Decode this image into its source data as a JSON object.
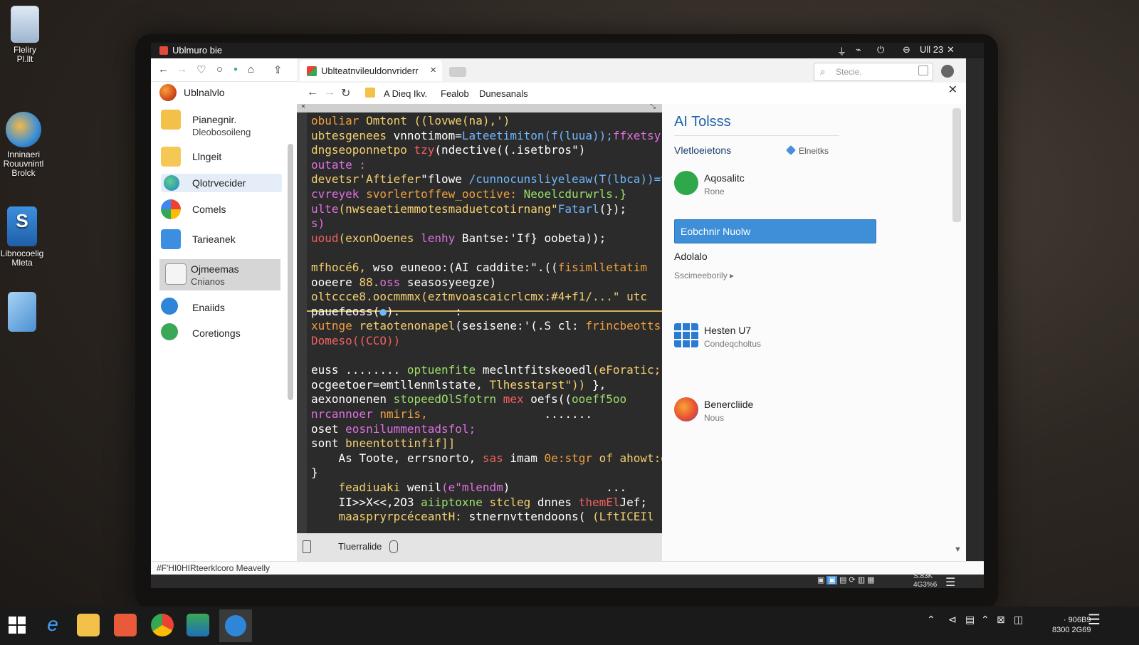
{
  "desktop_icons": [
    {
      "label_l1": "Fleliry",
      "label_l2": "Pl.llt"
    },
    {
      "label_l1": "Inninaeri",
      "label_l2": "Rouuvnintl",
      "label_l3": "Brolck"
    },
    {
      "label_l1": "Libnocoelig",
      "label_l2": "Mleta"
    },
    {
      "label_l1": ""
    }
  ],
  "window": {
    "title": "Ublmuro bie",
    "controls": [
      "⏚",
      "⌁",
      "⏻",
      "⊖",
      "Ull 23",
      "✕"
    ]
  },
  "file_manager": {
    "user": "Ublnalvlo",
    "items": [
      {
        "label": "Pianegnir.",
        "sub": "Dleobosoileng",
        "icon": "folder-doc-icon"
      },
      {
        "label": "Llngeit",
        "icon": "folder-icon"
      },
      {
        "label": "Qlotrvecider",
        "icon": "edge-icon"
      },
      {
        "label": "Comels",
        "icon": "cloud-icon"
      },
      {
        "label": "Tarieanek",
        "icon": "folder-blue-icon"
      },
      {
        "label": "Ojmeemas",
        "sub": "Cnianos",
        "icon": "file-icon"
      },
      {
        "label": "Enaiids",
        "icon": "refresh-icon"
      },
      {
        "label": "Coretiongs",
        "icon": "wrench-icon"
      }
    ],
    "status": "#F'HI0HIRteerklcoro Meavelly"
  },
  "browser": {
    "tab_title": "Ublteatnvileuldonvriderr",
    "search_placeholder": "Stecie.",
    "address_parts": [
      "A Dieq Ikv.",
      "Fealob",
      "Dunesanals"
    ]
  },
  "editor": {
    "footer_label": "Tluerralide",
    "lines": [
      {
        "segments": [
          {
            "t": "obuliar ",
            "c": "#f0a040"
          },
          {
            "t": "Omtont ((lovwe(na),')",
            "c": "#f4d06f"
          }
        ]
      },
      {
        "segments": [
          {
            "t": "ubtesgenees ",
            "c": "#f4d06f"
          },
          {
            "t": "vnnotimom=",
            "c": "#ffffff"
          },
          {
            "t": "Lateetimiton(f(luua));",
            "c": "#6fb8ff"
          },
          {
            "t": "ffxetsy",
            "c": "#e070e0"
          }
        ]
      },
      {
        "segments": [
          {
            "t": "dngseoponnetpo ",
            "c": "#f4d06f"
          },
          {
            "t": "tzy",
            "c": "#f06060"
          },
          {
            "t": "(ndective((.isetbros\")",
            "c": "#ffffff"
          }
        ]
      },
      {
        "segments": [
          {
            "t": "outate :",
            "c": "#e070e0"
          }
        ]
      },
      {
        "segments": [
          {
            "t": "devetsr'Aftiefer",
            "c": "#f4d06f"
          },
          {
            "t": "\"flowe ",
            "c": "#ffffff"
          },
          {
            "t": "/cunnocunsliyeleaw(T(lbca))=vsr",
            "c": "#6fb8ff"
          }
        ]
      },
      {
        "segments": [
          {
            "t": "cvreyek ",
            "c": "#e070e0"
          },
          {
            "t": "svorlertoffew_ooctive: ",
            "c": "#f0a040"
          },
          {
            "t": "Neoelcdurwrls.}",
            "c": "#9be06b"
          }
        ]
      },
      {
        "segments": [
          {
            "t": "ulte",
            "c": "#e070e0"
          },
          {
            "t": "(nwseaetiemmotesmaduetcotirnang\"",
            "c": "#f4d06f"
          },
          {
            "t": "Fatarl",
            "c": "#6fb8ff"
          },
          {
            "t": "(});",
            "c": "#ffffff"
          }
        ]
      },
      {
        "segments": [
          {
            "t": "s)",
            "c": "#e070e0"
          }
        ]
      },
      {
        "segments": [
          {
            "t": "uoud",
            "c": "#f06060"
          },
          {
            "t": "(exonOoenes ",
            "c": "#f4d06f"
          },
          {
            "t": "lenhy ",
            "c": "#e070e0"
          },
          {
            "t": "Bantse:'If} ",
            "c": "#ffffff"
          },
          {
            "t": "oobeta));",
            "c": "#ffffff"
          }
        ]
      },
      {
        "segments": [
          {
            "t": "",
            "c": "#ffffff"
          }
        ]
      },
      {
        "segments": [
          {
            "t": "mfhocé6, ",
            "c": "#f4d06f"
          },
          {
            "t": "wso euneoo:(AI caddite:\".((",
            "c": "#ffffff"
          },
          {
            "t": "fisimlletatim",
            "c": "#f0a040"
          }
        ]
      },
      {
        "segments": [
          {
            "t": "ooeere ",
            "c": "#ffffff"
          },
          {
            "t": "88.",
            "c": "#f4d06f"
          },
          {
            "t": "oss ",
            "c": "#e070e0"
          },
          {
            "t": "seasosyeegze)",
            "c": "#ffffff"
          }
        ]
      },
      {
        "segments": [
          {
            "t": "oltccce8.oocmmmx(eztmvoascaicrlcmx:#4+f1/...\" utc",
            "c": "#f4d06f"
          }
        ]
      },
      {
        "segments": [
          {
            "t": "pauefeoss(",
            "c": "#ffffff"
          },
          {
            "t": "●",
            "c": "#6fb8ff"
          },
          {
            "t": ").        :",
            "c": "#ffffff"
          }
        ]
      },
      {
        "segments": [
          {
            "t": "xutnge ",
            "c": "#f0a040"
          },
          {
            "t": "retaotenonapel",
            "c": "#f4d06f"
          },
          {
            "t": "(sesisene:'(.S cl: ",
            "c": "#ffffff"
          },
          {
            "t": "frincbeotts-%",
            "c": "#f0a040"
          }
        ]
      },
      {
        "segments": [
          {
            "t": "Domeso((CCO))",
            "c": "#f06060"
          }
        ]
      },
      {
        "segments": [
          {
            "t": "",
            "c": "#ffffff"
          }
        ]
      },
      {
        "segments": [
          {
            "t": "euss ........ ",
            "c": "#ffffff"
          },
          {
            "t": "optuenfite ",
            "c": "#9be06b"
          },
          {
            "t": "meclntfitskeoedl",
            "c": "#ffffff"
          },
          {
            "t": "(eForatic;('ofmm",
            "c": "#f4d06f"
          }
        ]
      },
      {
        "segments": [
          {
            "t": "ocgeetoer=emtllenmlstate, ",
            "c": "#ffffff"
          },
          {
            "t": "Tlhesstarst\")) ",
            "c": "#f4d06f"
          },
          {
            "t": "},",
            "c": "#ffffff"
          }
        ]
      },
      {
        "segments": [
          {
            "t": "aexononenen ",
            "c": "#ffffff"
          },
          {
            "t": "stopeedOlSfotrn ",
            "c": "#9be06b"
          },
          {
            "t": "mex ",
            "c": "#f06060"
          },
          {
            "t": "oefs((",
            "c": "#ffffff"
          },
          {
            "t": "ooeff5oo",
            "c": "#9be06b"
          }
        ]
      },
      {
        "segments": [
          {
            "t": "nrcannoer ",
            "c": "#e070e0"
          },
          {
            "t": "nmiris,",
            "c": "#f0a040"
          },
          {
            "t": "                 .......",
            "c": "#ffffff"
          }
        ]
      },
      {
        "segments": [
          {
            "t": "oset ",
            "c": "#ffffff"
          },
          {
            "t": "eosnilummentadsfol;",
            "c": "#e070e0"
          }
        ]
      },
      {
        "segments": [
          {
            "t": "sont ",
            "c": "#ffffff"
          },
          {
            "t": "bneentottinfif]]",
            "c": "#f4d06f"
          }
        ]
      },
      {
        "segments": [
          {
            "t": "    As ",
            "c": "#ffffff"
          },
          {
            "t": "Toote, ",
            "c": "#ffffff"
          },
          {
            "t": "errsnorto, ",
            "c": "#ffffff"
          },
          {
            "t": "sas ",
            "c": "#f06060"
          },
          {
            "t": "imam ",
            "c": "#ffffff"
          },
          {
            "t": "0e:stgr ",
            "c": "#f0a040"
          },
          {
            "t": "of ahowt:gl",
            "c": "#f4d06f"
          }
        ]
      },
      {
        "segments": [
          {
            "t": "}",
            "c": "#ffffff"
          }
        ]
      },
      {
        "segments": [
          {
            "t": "    feadiuaki ",
            "c": "#f4d06f"
          },
          {
            "t": "wenil",
            "c": "#ffffff"
          },
          {
            "t": "(e\"mlendm",
            "c": "#e070e0"
          },
          {
            "t": ")              ...",
            "c": "#ffffff"
          }
        ]
      },
      {
        "segments": [
          {
            "t": "    II>>X<<,2O3 ",
            "c": "#ffffff"
          },
          {
            "t": "aiiptoxne ",
            "c": "#9be06b"
          },
          {
            "t": "stcleg ",
            "c": "#f4d06f"
          },
          {
            "t": "dnnes ",
            "c": "#ffffff"
          },
          {
            "t": "themEl",
            "c": "#f06060"
          },
          {
            "t": "Jef;",
            "c": "#ffffff"
          }
        ]
      },
      {
        "segments": [
          {
            "t": "    maaspryrpcéceantH: ",
            "c": "#f4d06f"
          },
          {
            "t": "stnernvttendoons( ",
            "c": "#ffffff"
          },
          {
            "t": "(LftICEIl",
            "c": "#f4d06f"
          }
        ]
      }
    ]
  },
  "ai_panel": {
    "title": "AI Tolsss",
    "section": "Vletloeietons",
    "extensions_label": "Elneitks",
    "items": [
      {
        "name": "Aqosalitc",
        "sub": "Rone",
        "color": "#2ea84a"
      },
      {
        "name": "Hesten U7",
        "sub": "Condeqcholtus",
        "color": "#2b7bd1"
      },
      {
        "name": "Benercliide",
        "sub": "Nous",
        "color": "#e9512f"
      }
    ],
    "button": "Eobchnir Nuolw",
    "label2": "Adolalo",
    "sub2": "Sscimeeborily"
  },
  "screen_tray": {
    "time1": "S.83K",
    "time2": "4G3%6"
  },
  "taskbar": {
    "clock_time": "· 906B9",
    "clock_date": "8300 2G69"
  }
}
